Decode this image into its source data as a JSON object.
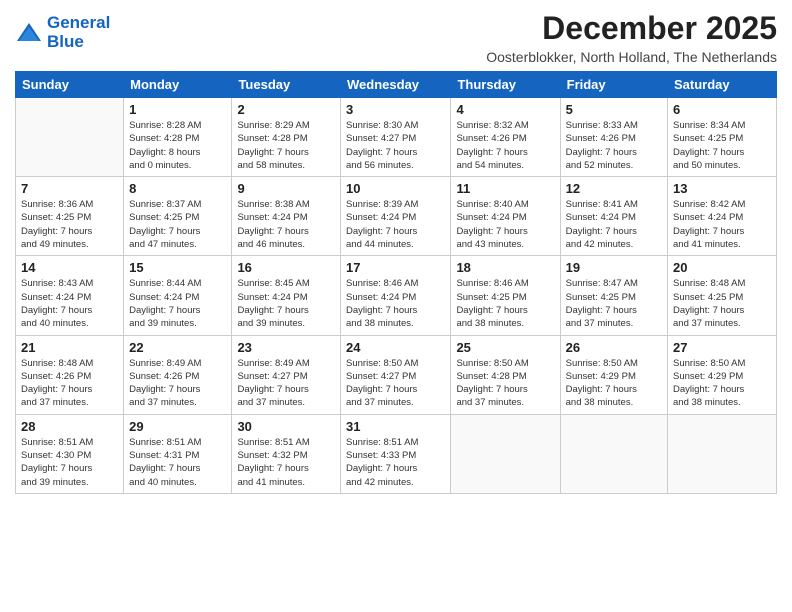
{
  "header": {
    "logo_line1": "General",
    "logo_line2": "Blue",
    "month": "December 2025",
    "location": "Oosterblokker, North Holland, The Netherlands"
  },
  "days_of_week": [
    "Sunday",
    "Monday",
    "Tuesday",
    "Wednesday",
    "Thursday",
    "Friday",
    "Saturday"
  ],
  "weeks": [
    [
      {
        "day": "",
        "info": ""
      },
      {
        "day": "1",
        "info": "Sunrise: 8:28 AM\nSunset: 4:28 PM\nDaylight: 8 hours\nand 0 minutes."
      },
      {
        "day": "2",
        "info": "Sunrise: 8:29 AM\nSunset: 4:28 PM\nDaylight: 7 hours\nand 58 minutes."
      },
      {
        "day": "3",
        "info": "Sunrise: 8:30 AM\nSunset: 4:27 PM\nDaylight: 7 hours\nand 56 minutes."
      },
      {
        "day": "4",
        "info": "Sunrise: 8:32 AM\nSunset: 4:26 PM\nDaylight: 7 hours\nand 54 minutes."
      },
      {
        "day": "5",
        "info": "Sunrise: 8:33 AM\nSunset: 4:26 PM\nDaylight: 7 hours\nand 52 minutes."
      },
      {
        "day": "6",
        "info": "Sunrise: 8:34 AM\nSunset: 4:25 PM\nDaylight: 7 hours\nand 50 minutes."
      }
    ],
    [
      {
        "day": "7",
        "info": "Sunrise: 8:36 AM\nSunset: 4:25 PM\nDaylight: 7 hours\nand 49 minutes."
      },
      {
        "day": "8",
        "info": "Sunrise: 8:37 AM\nSunset: 4:25 PM\nDaylight: 7 hours\nand 47 minutes."
      },
      {
        "day": "9",
        "info": "Sunrise: 8:38 AM\nSunset: 4:24 PM\nDaylight: 7 hours\nand 46 minutes."
      },
      {
        "day": "10",
        "info": "Sunrise: 8:39 AM\nSunset: 4:24 PM\nDaylight: 7 hours\nand 44 minutes."
      },
      {
        "day": "11",
        "info": "Sunrise: 8:40 AM\nSunset: 4:24 PM\nDaylight: 7 hours\nand 43 minutes."
      },
      {
        "day": "12",
        "info": "Sunrise: 8:41 AM\nSunset: 4:24 PM\nDaylight: 7 hours\nand 42 minutes."
      },
      {
        "day": "13",
        "info": "Sunrise: 8:42 AM\nSunset: 4:24 PM\nDaylight: 7 hours\nand 41 minutes."
      }
    ],
    [
      {
        "day": "14",
        "info": "Sunrise: 8:43 AM\nSunset: 4:24 PM\nDaylight: 7 hours\nand 40 minutes."
      },
      {
        "day": "15",
        "info": "Sunrise: 8:44 AM\nSunset: 4:24 PM\nDaylight: 7 hours\nand 39 minutes."
      },
      {
        "day": "16",
        "info": "Sunrise: 8:45 AM\nSunset: 4:24 PM\nDaylight: 7 hours\nand 39 minutes."
      },
      {
        "day": "17",
        "info": "Sunrise: 8:46 AM\nSunset: 4:24 PM\nDaylight: 7 hours\nand 38 minutes."
      },
      {
        "day": "18",
        "info": "Sunrise: 8:46 AM\nSunset: 4:25 PM\nDaylight: 7 hours\nand 38 minutes."
      },
      {
        "day": "19",
        "info": "Sunrise: 8:47 AM\nSunset: 4:25 PM\nDaylight: 7 hours\nand 37 minutes."
      },
      {
        "day": "20",
        "info": "Sunrise: 8:48 AM\nSunset: 4:25 PM\nDaylight: 7 hours\nand 37 minutes."
      }
    ],
    [
      {
        "day": "21",
        "info": "Sunrise: 8:48 AM\nSunset: 4:26 PM\nDaylight: 7 hours\nand 37 minutes."
      },
      {
        "day": "22",
        "info": "Sunrise: 8:49 AM\nSunset: 4:26 PM\nDaylight: 7 hours\nand 37 minutes."
      },
      {
        "day": "23",
        "info": "Sunrise: 8:49 AM\nSunset: 4:27 PM\nDaylight: 7 hours\nand 37 minutes."
      },
      {
        "day": "24",
        "info": "Sunrise: 8:50 AM\nSunset: 4:27 PM\nDaylight: 7 hours\nand 37 minutes."
      },
      {
        "day": "25",
        "info": "Sunrise: 8:50 AM\nSunset: 4:28 PM\nDaylight: 7 hours\nand 37 minutes."
      },
      {
        "day": "26",
        "info": "Sunrise: 8:50 AM\nSunset: 4:29 PM\nDaylight: 7 hours\nand 38 minutes."
      },
      {
        "day": "27",
        "info": "Sunrise: 8:50 AM\nSunset: 4:29 PM\nDaylight: 7 hours\nand 38 minutes."
      }
    ],
    [
      {
        "day": "28",
        "info": "Sunrise: 8:51 AM\nSunset: 4:30 PM\nDaylight: 7 hours\nand 39 minutes."
      },
      {
        "day": "29",
        "info": "Sunrise: 8:51 AM\nSunset: 4:31 PM\nDaylight: 7 hours\nand 40 minutes."
      },
      {
        "day": "30",
        "info": "Sunrise: 8:51 AM\nSunset: 4:32 PM\nDaylight: 7 hours\nand 41 minutes."
      },
      {
        "day": "31",
        "info": "Sunrise: 8:51 AM\nSunset: 4:33 PM\nDaylight: 7 hours\nand 42 minutes."
      },
      {
        "day": "",
        "info": ""
      },
      {
        "day": "",
        "info": ""
      },
      {
        "day": "",
        "info": ""
      }
    ]
  ]
}
